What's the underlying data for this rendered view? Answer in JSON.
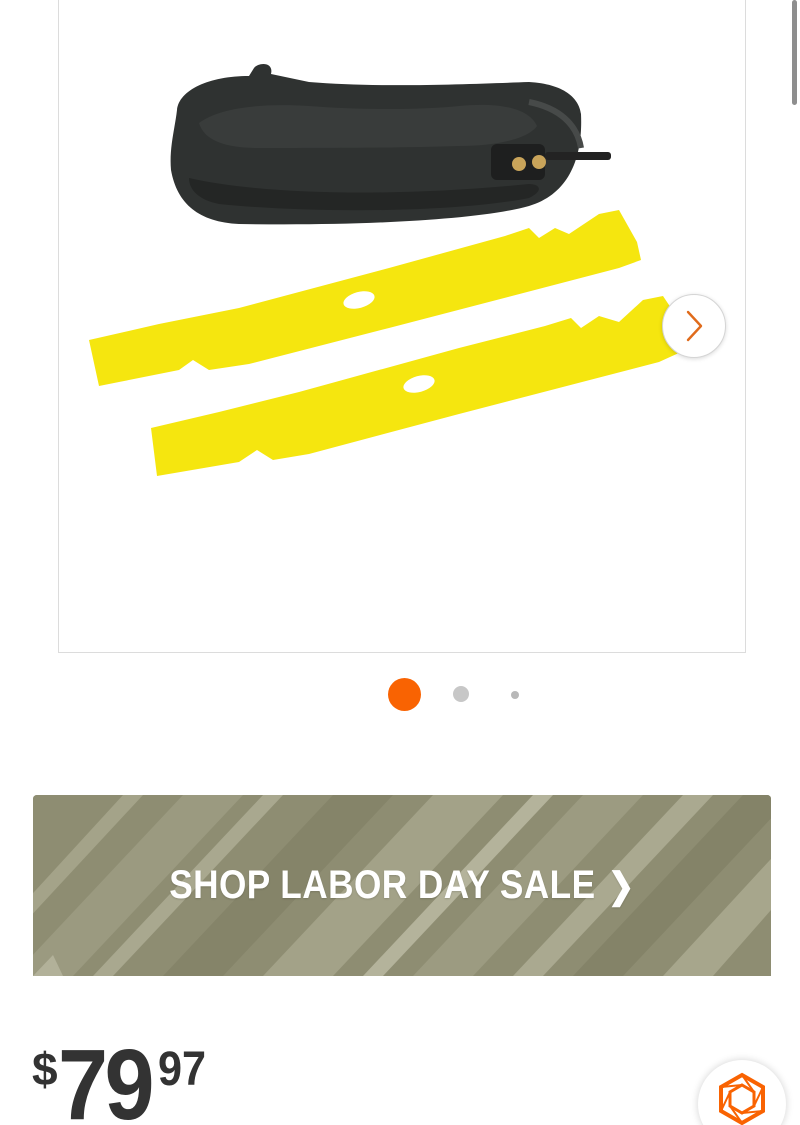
{
  "gallery": {
    "image_alt": "Mower blade kit with black deflector chute and two yellow blades",
    "next_icon": "chevron-right-icon",
    "slide_count": 3,
    "active_slide": 1
  },
  "promo_banner": {
    "label": "SHOP LABOR DAY SALE",
    "chevron": "❯"
  },
  "price": {
    "currency": "$",
    "dollars": "79",
    "cents": "97"
  },
  "chat": {
    "icon": "hexagon-chat-icon"
  },
  "colors": {
    "accent": "#f96302",
    "text": "#333333",
    "banner": "#8f8f72"
  }
}
